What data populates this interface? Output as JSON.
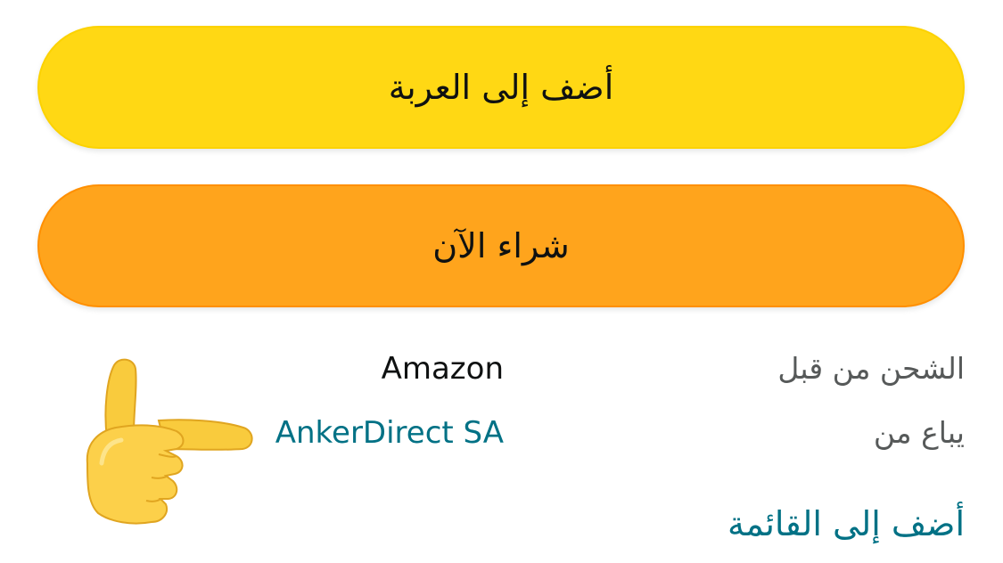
{
  "buttons": {
    "add_to_cart": "أضف إلى العربة",
    "buy_now": "شراء الآن"
  },
  "info": {
    "ships_from_label": "الشحن من قبل",
    "ships_from_value": "Amazon",
    "sold_by_label": "يباع من",
    "sold_by_value": "AnkerDirect SA"
  },
  "links": {
    "add_to_list": "أضف إلى القائمة"
  },
  "icons": {
    "pointer": "backhand-index-pointing-right-emoji"
  },
  "colors": {
    "add_to_cart_bg": "#ffd814",
    "buy_now_bg": "#ffa41c",
    "link": "#007185",
    "label": "#565959"
  }
}
